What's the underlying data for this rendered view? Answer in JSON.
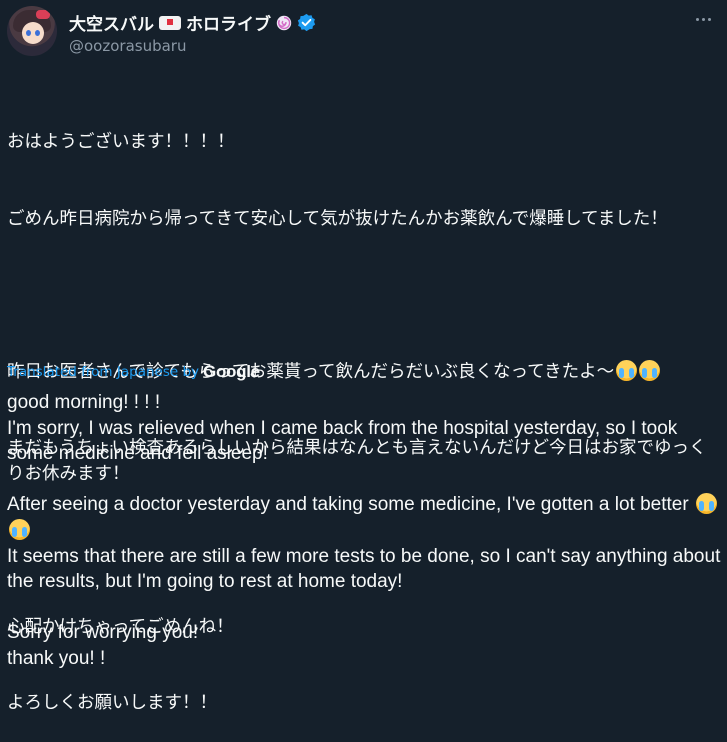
{
  "header": {
    "display_name_prefix": "大空スバル",
    "display_name_suffix": "ホロライブ",
    "handle": "@oozorasubaru",
    "icons": [
      "avatar",
      "ambulance-emoji",
      "lollipop-emoji",
      "verified-badge-icon",
      "more-options-icon"
    ]
  },
  "original": {
    "line1": "おはようございます！！！！",
    "line2": "ごめん昨日病院から帰ってきて安心して気が抜けたんかお薬飲んで爆睡してました！",
    "line3": "昨日お医者さんで診てもらってお薬貰って飲んだらだいぶ良くなってきたよ〜",
    "line4": "まだもうちょい検査あるらしいから結果はなんとも言えないんだけど今日はお家でゆっくりお休みます！",
    "line5": "心配かけちゃってごめんね！",
    "line6": "よろしくお願いします！！"
  },
  "translation_notice": {
    "label": "Translated from Japanese by",
    "provider": "Google"
  },
  "translation": {
    "line1": "good morning! ! ! !",
    "line2": "I'm sorry, I was relieved when I came back from the hospital yesterday, so I took some medicine and fell asleep!",
    "line3": "After seeing a doctor yesterday and taking some medicine, I've gotten a lot better",
    "line4": "It seems that there are still a few more tests to be done, so I can't say anything about the results, but I'm going to rest at home today!",
    "line5": "Sorry for worrying you!",
    "line6": "thank you! !"
  },
  "colors": {
    "background": "#15202b",
    "text": "#f7f9f9",
    "muted": "#8b98a5",
    "accent": "#1d9bf0"
  }
}
